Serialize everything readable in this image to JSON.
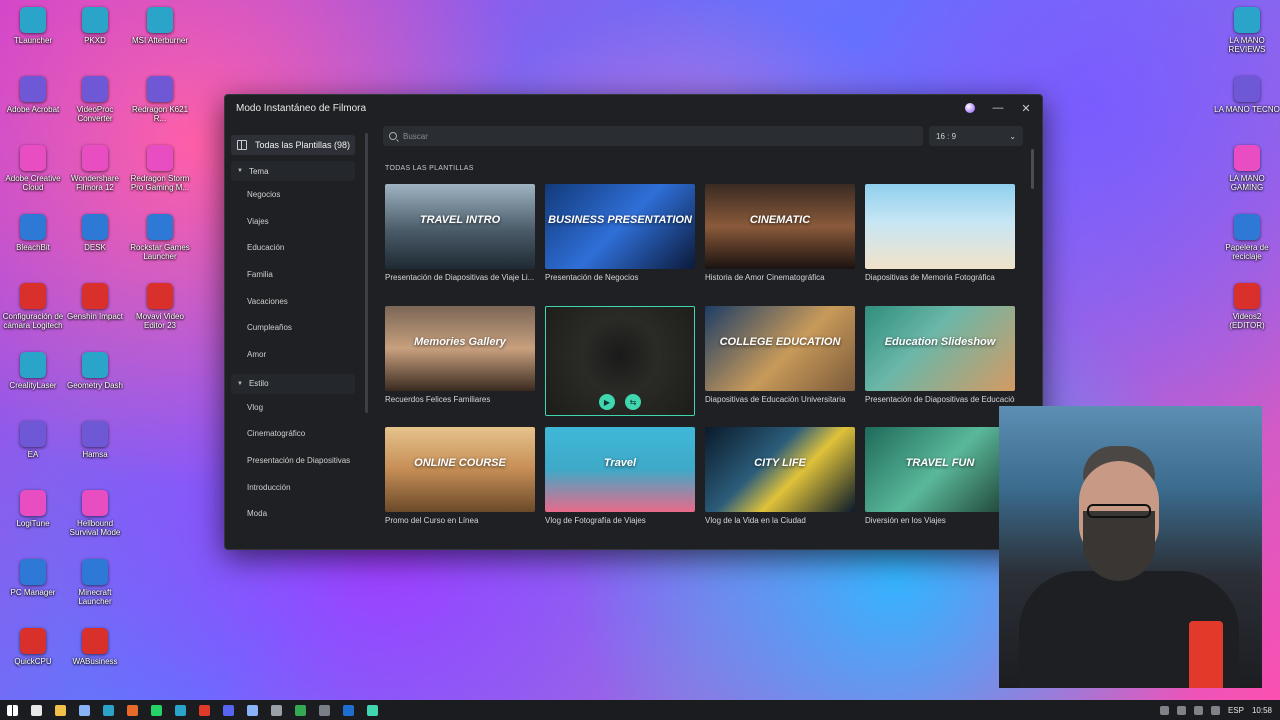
{
  "desktop": {
    "left_col": [
      "TLauncher",
      "Adobe Acrobat",
      "Adobe Creative Cloud",
      "BleachBit",
      "Configuración de cámara Logitech",
      "CrealityLaser",
      "EA",
      "LogiTune",
      "PC Manager",
      "QuickCPU"
    ],
    "col2": [
      "PKXD",
      "VideoProc Converter",
      "Wondershare Filmora 12",
      "DESK",
      "Genshin Impact",
      "Geometry Dash",
      "Hamsa",
      "Hellbound Survival Mode",
      "Minecraft Launcher",
      "WABusiness"
    ],
    "col3": [
      "MSI Afterburner",
      "Redragon K621 R...",
      "Redragon Storm Pro Gaming M...",
      "Rockstar Games Launcher",
      "Movavi Video Editor 23"
    ],
    "right_col": [
      "LA MANO REVIEWS",
      "LA MANO TECNO",
      "LA MANO GAMING",
      "Papelera de reciclaje",
      "Videos2 (EDITOR)"
    ]
  },
  "window": {
    "title": "Modo Instantáneo de Filmora",
    "minimize": "—",
    "close": "✕"
  },
  "sidebar": {
    "all_templates": "Todas las Plantillas (98)",
    "group_tema": "Tema",
    "tema_items": [
      "Negocios",
      "Viajes",
      "Educación",
      "Familia",
      "Vacaciones",
      "Cumpleaños",
      "Amor"
    ],
    "group_estilo": "Estilo",
    "estilo_items": [
      "Vlog",
      "Cinematográfico",
      "Presentación de Diapositivas",
      "Introducción",
      "Moda"
    ]
  },
  "main": {
    "search_placeholder": "Buscar",
    "ratio": "16 : 9",
    "section_title": "TODAS LAS PLANTILLAS",
    "cards": [
      {
        "caption": "Presentación de Diapositivas de Viaje Li...",
        "overlay": "TRAVEL INTRO"
      },
      {
        "caption": "Presentación de Negocios",
        "overlay": "BUSINESS PRESENTATION"
      },
      {
        "caption": "Historia de Amor Cinematográfica",
        "overlay": "CINEMATIC"
      },
      {
        "caption": "Diapositivas de Memoria Fotográfica",
        "overlay": ""
      },
      {
        "caption": "Recuerdos Felices Familiares",
        "overlay": "Memories Gallery"
      },
      {
        "caption": "",
        "overlay": ""
      },
      {
        "caption": "Diapositivas de Educación Universitaria",
        "overlay": "COLLEGE EDUCATION"
      },
      {
        "caption": "Presentación de Diapositivas de Educación",
        "overlay": "Education Slideshow"
      },
      {
        "caption": "Promo del Curso en Línea",
        "overlay": "ONLINE COURSE"
      },
      {
        "caption": "Vlog de Fotografía de Viajes",
        "overlay": "Travel"
      },
      {
        "caption": "Vlog de la Vida en la Ciudad",
        "overlay": "CITY LIFE"
      },
      {
        "caption": "Diversión en los Viajes",
        "overlay": "TRAVEL FUN"
      }
    ]
  },
  "taskbar": {
    "lang": "ESP",
    "time": "10:58"
  }
}
